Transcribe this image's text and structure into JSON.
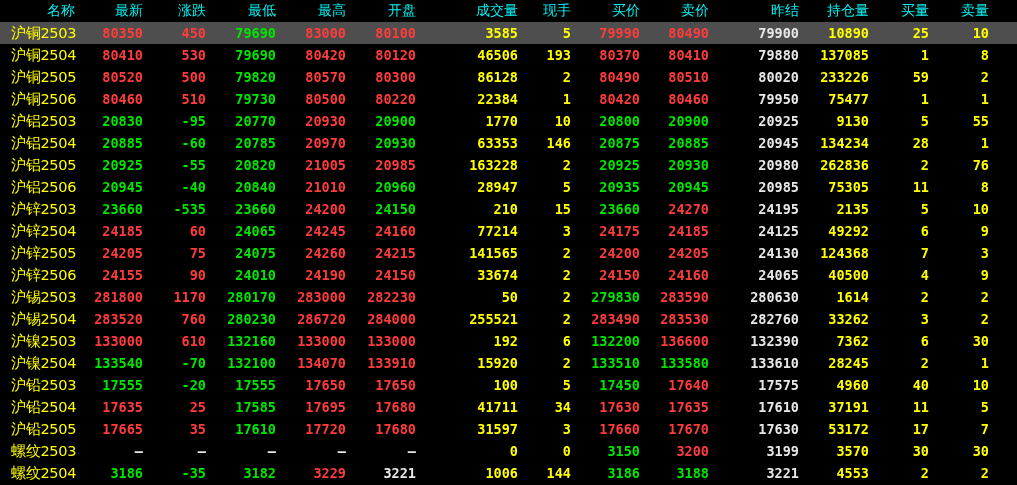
{
  "columns": [
    {
      "label": "名称",
      "kind": "name"
    },
    {
      "label": "最新",
      "kind": "price"
    },
    {
      "label": "涨跌",
      "kind": "price"
    },
    {
      "label": "最低",
      "kind": "price"
    },
    {
      "label": "最高",
      "kind": "price"
    },
    {
      "label": "开盘",
      "kind": "price"
    },
    {
      "label": "成交量",
      "kind": "volume"
    },
    {
      "label": "现手",
      "kind": "volume"
    },
    {
      "label": "买价",
      "kind": "price"
    },
    {
      "label": "卖价",
      "kind": "price"
    },
    {
      "label": "昨结",
      "kind": "settle"
    },
    {
      "label": "持仓量",
      "kind": "volume"
    },
    {
      "label": "买量",
      "kind": "volume"
    },
    {
      "label": "卖量",
      "kind": "volume"
    }
  ],
  "rows": [
    {
      "name": "沪铜2503",
      "selected": true,
      "cells": [
        {
          "text": "80350",
          "color": "#ff3c3c"
        },
        {
          "text": "450",
          "color": "#ff3c3c"
        },
        {
          "text": "79690",
          "color": "#00e600"
        },
        {
          "text": "83000",
          "color": "#ff3c3c"
        },
        {
          "text": "80100",
          "color": "#ff3c3c"
        },
        "3585",
        "5",
        {
          "text": "79990",
          "color": "#ff3c3c"
        },
        {
          "text": "80490",
          "color": "#ff3c3c"
        },
        "79900",
        "10890",
        "25",
        "10"
      ]
    },
    {
      "name": "沪铜2504",
      "selected": false,
      "cells": [
        {
          "text": "80410",
          "color": "#ff3c3c"
        },
        {
          "text": "530",
          "color": "#ff3c3c"
        },
        {
          "text": "79690",
          "color": "#00e600"
        },
        {
          "text": "80420",
          "color": "#ff3c3c"
        },
        {
          "text": "80120",
          "color": "#ff3c3c"
        },
        "46506",
        "193",
        {
          "text": "80370",
          "color": "#ff3c3c"
        },
        {
          "text": "80410",
          "color": "#ff3c3c"
        },
        "79880",
        "137085",
        "1",
        "8"
      ]
    },
    {
      "name": "沪铜2505",
      "selected": false,
      "cells": [
        {
          "text": "80520",
          "color": "#ff3c3c"
        },
        {
          "text": "500",
          "color": "#ff3c3c"
        },
        {
          "text": "79820",
          "color": "#00e600"
        },
        {
          "text": "80570",
          "color": "#ff3c3c"
        },
        {
          "text": "80300",
          "color": "#ff3c3c"
        },
        "86128",
        "2",
        {
          "text": "80490",
          "color": "#ff3c3c"
        },
        {
          "text": "80510",
          "color": "#ff3c3c"
        },
        "80020",
        "233226",
        "59",
        "2"
      ]
    },
    {
      "name": "沪铜2506",
      "selected": false,
      "cells": [
        {
          "text": "80460",
          "color": "#ff3c3c"
        },
        {
          "text": "510",
          "color": "#ff3c3c"
        },
        {
          "text": "79730",
          "color": "#00e600"
        },
        {
          "text": "80500",
          "color": "#ff3c3c"
        },
        {
          "text": "80220",
          "color": "#ff3c3c"
        },
        "22384",
        "1",
        {
          "text": "80420",
          "color": "#ff3c3c"
        },
        {
          "text": "80460",
          "color": "#ff3c3c"
        },
        "79950",
        "75477",
        "1",
        "1"
      ]
    },
    {
      "name": "沪铝2503",
      "selected": false,
      "cells": [
        {
          "text": "20830",
          "color": "#00e600"
        },
        {
          "text": "-95",
          "color": "#00e600"
        },
        {
          "text": "20770",
          "color": "#00e600"
        },
        {
          "text": "20930",
          "color": "#ff3c3c"
        },
        {
          "text": "20900",
          "color": "#00e600"
        },
        "1770",
        "10",
        {
          "text": "20800",
          "color": "#00e600"
        },
        {
          "text": "20900",
          "color": "#00e600"
        },
        "20925",
        "9130",
        "5",
        "55"
      ]
    },
    {
      "name": "沪铝2504",
      "selected": false,
      "cells": [
        {
          "text": "20885",
          "color": "#00e600"
        },
        {
          "text": "-60",
          "color": "#00e600"
        },
        {
          "text": "20785",
          "color": "#00e600"
        },
        {
          "text": "20970",
          "color": "#ff3c3c"
        },
        {
          "text": "20930",
          "color": "#00e600"
        },
        "63353",
        "146",
        {
          "text": "20875",
          "color": "#00e600"
        },
        {
          "text": "20885",
          "color": "#00e600"
        },
        "20945",
        "134234",
        "28",
        "1"
      ]
    },
    {
      "name": "沪铝2505",
      "selected": false,
      "cells": [
        {
          "text": "20925",
          "color": "#00e600"
        },
        {
          "text": "-55",
          "color": "#00e600"
        },
        {
          "text": "20820",
          "color": "#00e600"
        },
        {
          "text": "21005",
          "color": "#ff3c3c"
        },
        {
          "text": "20985",
          "color": "#ff3c3c"
        },
        "163228",
        "2",
        {
          "text": "20925",
          "color": "#00e600"
        },
        {
          "text": "20930",
          "color": "#00e600"
        },
        "20980",
        "262836",
        "2",
        "76"
      ]
    },
    {
      "name": "沪铝2506",
      "selected": false,
      "cells": [
        {
          "text": "20945",
          "color": "#00e600"
        },
        {
          "text": "-40",
          "color": "#00e600"
        },
        {
          "text": "20840",
          "color": "#00e600"
        },
        {
          "text": "21010",
          "color": "#ff3c3c"
        },
        {
          "text": "20960",
          "color": "#00e600"
        },
        "28947",
        "5",
        {
          "text": "20935",
          "color": "#00e600"
        },
        {
          "text": "20945",
          "color": "#00e600"
        },
        "20985",
        "75305",
        "11",
        "8"
      ]
    },
    {
      "name": "沪锌2503",
      "selected": false,
      "cells": [
        {
          "text": "23660",
          "color": "#00e600"
        },
        {
          "text": "-535",
          "color": "#00e600"
        },
        {
          "text": "23660",
          "color": "#00e600"
        },
        {
          "text": "24200",
          "color": "#ff3c3c"
        },
        {
          "text": "24150",
          "color": "#00e600"
        },
        "210",
        "15",
        {
          "text": "23660",
          "color": "#00e600"
        },
        {
          "text": "24270",
          "color": "#ff3c3c"
        },
        "24195",
        "2135",
        "5",
        "10"
      ]
    },
    {
      "name": "沪锌2504",
      "selected": false,
      "cells": [
        {
          "text": "24185",
          "color": "#ff3c3c"
        },
        {
          "text": "60",
          "color": "#ff3c3c"
        },
        {
          "text": "24065",
          "color": "#00e600"
        },
        {
          "text": "24245",
          "color": "#ff3c3c"
        },
        {
          "text": "24160",
          "color": "#ff3c3c"
        },
        "77214",
        "3",
        {
          "text": "24175",
          "color": "#ff3c3c"
        },
        {
          "text": "24185",
          "color": "#ff3c3c"
        },
        "24125",
        "49292",
        "6",
        "9"
      ]
    },
    {
      "name": "沪锌2505",
      "selected": false,
      "cells": [
        {
          "text": "24205",
          "color": "#ff3c3c"
        },
        {
          "text": "75",
          "color": "#ff3c3c"
        },
        {
          "text": "24075",
          "color": "#00e600"
        },
        {
          "text": "24260",
          "color": "#ff3c3c"
        },
        {
          "text": "24215",
          "color": "#ff3c3c"
        },
        "141565",
        "2",
        {
          "text": "24200",
          "color": "#ff3c3c"
        },
        {
          "text": "24205",
          "color": "#ff3c3c"
        },
        "24130",
        "124368",
        "7",
        "3"
      ]
    },
    {
      "name": "沪锌2506",
      "selected": false,
      "cells": [
        {
          "text": "24155",
          "color": "#ff3c3c"
        },
        {
          "text": "90",
          "color": "#ff3c3c"
        },
        {
          "text": "24010",
          "color": "#00e600"
        },
        {
          "text": "24190",
          "color": "#ff3c3c"
        },
        {
          "text": "24150",
          "color": "#ff3c3c"
        },
        "33674",
        "2",
        {
          "text": "24150",
          "color": "#ff3c3c"
        },
        {
          "text": "24160",
          "color": "#ff3c3c"
        },
        "24065",
        "40500",
        "4",
        "9"
      ]
    },
    {
      "name": "沪锡2503",
      "selected": false,
      "cells": [
        {
          "text": "281800",
          "color": "#ff3c3c"
        },
        {
          "text": "1170",
          "color": "#ff3c3c"
        },
        {
          "text": "280170",
          "color": "#00e600"
        },
        {
          "text": "283000",
          "color": "#ff3c3c"
        },
        {
          "text": "282230",
          "color": "#ff3c3c"
        },
        "50",
        "2",
        {
          "text": "279830",
          "color": "#00e600"
        },
        {
          "text": "283590",
          "color": "#ff3c3c"
        },
        "280630",
        "1614",
        "2",
        "2"
      ]
    },
    {
      "name": "沪锡2504",
      "selected": false,
      "cells": [
        {
          "text": "283520",
          "color": "#ff3c3c"
        },
        {
          "text": "760",
          "color": "#ff3c3c"
        },
        {
          "text": "280230",
          "color": "#00e600"
        },
        {
          "text": "286720",
          "color": "#ff3c3c"
        },
        {
          "text": "284000",
          "color": "#ff3c3c"
        },
        "255521",
        "2",
        {
          "text": "283490",
          "color": "#ff3c3c"
        },
        {
          "text": "283530",
          "color": "#ff3c3c"
        },
        "282760",
        "33262",
        "3",
        "2"
      ]
    },
    {
      "name": "沪镍2503",
      "selected": false,
      "cells": [
        {
          "text": "133000",
          "color": "#ff3c3c"
        },
        {
          "text": "610",
          "color": "#ff3c3c"
        },
        {
          "text": "132160",
          "color": "#00e600"
        },
        {
          "text": "133000",
          "color": "#ff3c3c"
        },
        {
          "text": "133000",
          "color": "#ff3c3c"
        },
        "192",
        "6",
        {
          "text": "132200",
          "color": "#00e600"
        },
        {
          "text": "136600",
          "color": "#ff3c3c"
        },
        "132390",
        "7362",
        "6",
        "30"
      ]
    },
    {
      "name": "沪镍2504",
      "selected": false,
      "cells": [
        {
          "text": "133540",
          "color": "#00e600"
        },
        {
          "text": "-70",
          "color": "#00e600"
        },
        {
          "text": "132100",
          "color": "#00e600"
        },
        {
          "text": "134070",
          "color": "#ff3c3c"
        },
        {
          "text": "133910",
          "color": "#ff3c3c"
        },
        "15920",
        "2",
        {
          "text": "133510",
          "color": "#00e600"
        },
        {
          "text": "133580",
          "color": "#00e600"
        },
        "133610",
        "28245",
        "2",
        "1"
      ]
    },
    {
      "name": "沪铅2503",
      "selected": false,
      "cells": [
        {
          "text": "17555",
          "color": "#00e600"
        },
        {
          "text": "-20",
          "color": "#00e600"
        },
        {
          "text": "17555",
          "color": "#00e600"
        },
        {
          "text": "17650",
          "color": "#ff3c3c"
        },
        {
          "text": "17650",
          "color": "#ff3c3c"
        },
        "100",
        "5",
        {
          "text": "17450",
          "color": "#00e600"
        },
        {
          "text": "17640",
          "color": "#ff3c3c"
        },
        "17575",
        "4960",
        "40",
        "10"
      ]
    },
    {
      "name": "沪铅2504",
      "selected": false,
      "cells": [
        {
          "text": "17635",
          "color": "#ff3c3c"
        },
        {
          "text": "25",
          "color": "#ff3c3c"
        },
        {
          "text": "17585",
          "color": "#00e600"
        },
        {
          "text": "17695",
          "color": "#ff3c3c"
        },
        {
          "text": "17680",
          "color": "#ff3c3c"
        },
        "41711",
        "34",
        {
          "text": "17630",
          "color": "#ff3c3c"
        },
        {
          "text": "17635",
          "color": "#ff3c3c"
        },
        "17610",
        "37191",
        "11",
        "5"
      ]
    },
    {
      "name": "沪铅2505",
      "selected": false,
      "cells": [
        {
          "text": "17665",
          "color": "#ff3c3c"
        },
        {
          "text": "35",
          "color": "#ff3c3c"
        },
        {
          "text": "17610",
          "color": "#00e600"
        },
        {
          "text": "17720",
          "color": "#ff3c3c"
        },
        {
          "text": "17680",
          "color": "#ff3c3c"
        },
        "31597",
        "3",
        {
          "text": "17660",
          "color": "#ff3c3c"
        },
        {
          "text": "17670",
          "color": "#ff3c3c"
        },
        "17630",
        "53172",
        "17",
        "7"
      ]
    },
    {
      "name": "螺纹2503",
      "selected": false,
      "cells": [
        {
          "text": "—",
          "color": "#e8e8e8"
        },
        {
          "text": "—",
          "color": "#e8e8e8"
        },
        {
          "text": "—",
          "color": "#e8e8e8"
        },
        {
          "text": "—",
          "color": "#e8e8e8"
        },
        {
          "text": "—",
          "color": "#e8e8e8"
        },
        "0",
        "0",
        {
          "text": "3150",
          "color": "#00e600"
        },
        {
          "text": "3200",
          "color": "#ff3c3c"
        },
        "3199",
        "3570",
        "30",
        "30"
      ]
    },
    {
      "name": "螺纹2504",
      "selected": false,
      "cells": [
        {
          "text": "3186",
          "color": "#00e600"
        },
        {
          "text": "-35",
          "color": "#00e600"
        },
        {
          "text": "3182",
          "color": "#00e600"
        },
        {
          "text": "3229",
          "color": "#ff3c3c"
        },
        {
          "text": "3221",
          "color": "#e8e8e8"
        },
        "1006",
        "144",
        {
          "text": "3186",
          "color": "#00e600"
        },
        {
          "text": "3188",
          "color": "#00e600"
        },
        "3221",
        "4553",
        "2",
        "2"
      ]
    }
  ]
}
